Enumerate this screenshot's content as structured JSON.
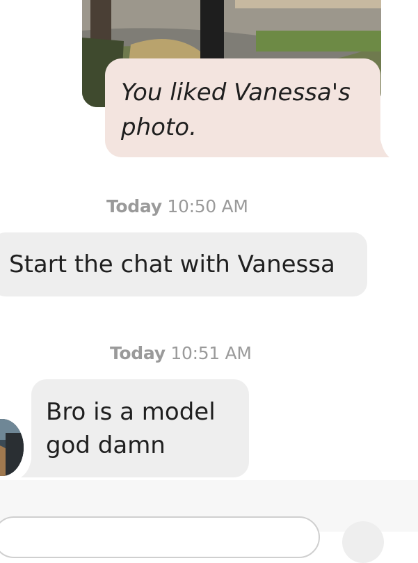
{
  "like_notice": {
    "text": "You liked Vanessa's photo."
  },
  "timestamps": [
    {
      "day": "Today",
      "time": "10:50 AM"
    },
    {
      "day": "Today",
      "time": "10:51 AM"
    }
  ],
  "system_prompt": {
    "text": "Start the chat with Vanessa"
  },
  "messages": [
    {
      "sender": "Vanessa",
      "text": "Bro is a model god damn"
    }
  ],
  "composer": {
    "placeholder": ""
  },
  "colors": {
    "like_bubble": "#f3e4df",
    "incoming_bubble": "#eeeeee",
    "timestamp": "#9a9a9a"
  },
  "icons": {
    "avatar": "vanessa-avatar",
    "send": "send-icon"
  }
}
